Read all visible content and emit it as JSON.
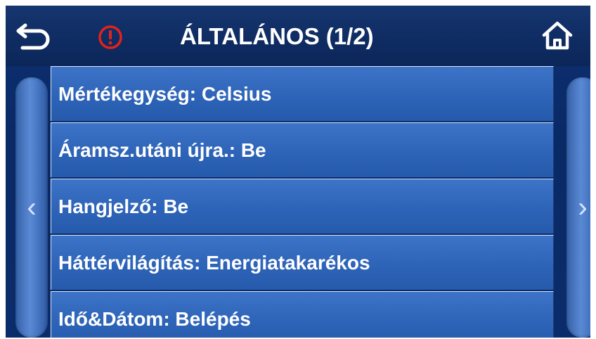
{
  "header": {
    "title": "ÁLTALÁNOS (1/2)",
    "back_icon": "back-arrow-icon",
    "alert_icon": "alert-icon",
    "home_icon": "home-icon",
    "alert_color": "#e0231b"
  },
  "nav": {
    "prev_glyph": "‹",
    "next_glyph": "›"
  },
  "menu": {
    "items": [
      {
        "label": "Mértékegység: Celsius"
      },
      {
        "label": "Áramsz.utáni újra.: Be"
      },
      {
        "label": "Hangjelző: Be"
      },
      {
        "label": "Háttérvilágítás: Energiatakarékos"
      },
      {
        "label": "Idő&Dátom: Belépés"
      }
    ]
  },
  "colors": {
    "background": "#0b2c6a",
    "item": "#2e64b8",
    "text": "#ffffff"
  }
}
